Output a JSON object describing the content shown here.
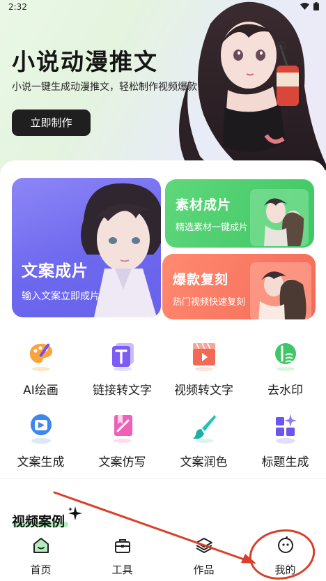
{
  "status_bar": {
    "time": "2:32"
  },
  "hero": {
    "title": "小说动漫推文",
    "subtitle": "小说一键生成动漫推文，轻松制作视频爆款",
    "cta_label": "立即制作"
  },
  "cards": {
    "main": {
      "title": "文案成片",
      "subtitle": "输入文案立即成片"
    },
    "material": {
      "title": "素材成片",
      "subtitle": "精选素材一键成片"
    },
    "trending": {
      "title": "爆款复刻",
      "subtitle": "热门视频快速复刻"
    }
  },
  "tools": [
    {
      "label": "AI绘画",
      "icon": "palette-icon"
    },
    {
      "label": "链接转文字",
      "icon": "text-t-icon"
    },
    {
      "label": "视频转文字",
      "icon": "video-play-icon"
    },
    {
      "label": "去水印",
      "icon": "watermark-remove-icon"
    },
    {
      "label": "文案生成",
      "icon": "doc-generate-icon"
    },
    {
      "label": "文案仿写",
      "icon": "bookmark-write-icon"
    },
    {
      "label": "文案润色",
      "icon": "brush-icon"
    },
    {
      "label": "标题生成",
      "icon": "grid-sparkle-icon"
    }
  ],
  "section": {
    "title": "视频案例"
  },
  "bottom_nav": [
    {
      "label": "首页",
      "icon": "home-icon"
    },
    {
      "label": "工具",
      "icon": "toolbox-icon"
    },
    {
      "label": "作品",
      "icon": "layers-icon"
    },
    {
      "label": "我的",
      "icon": "smiley-profile-icon"
    }
  ],
  "colors": {
    "primary_card": "#6d68ee",
    "green_card": "#46c96a",
    "red_card": "#f46a57",
    "annotation": "#d9402a"
  }
}
